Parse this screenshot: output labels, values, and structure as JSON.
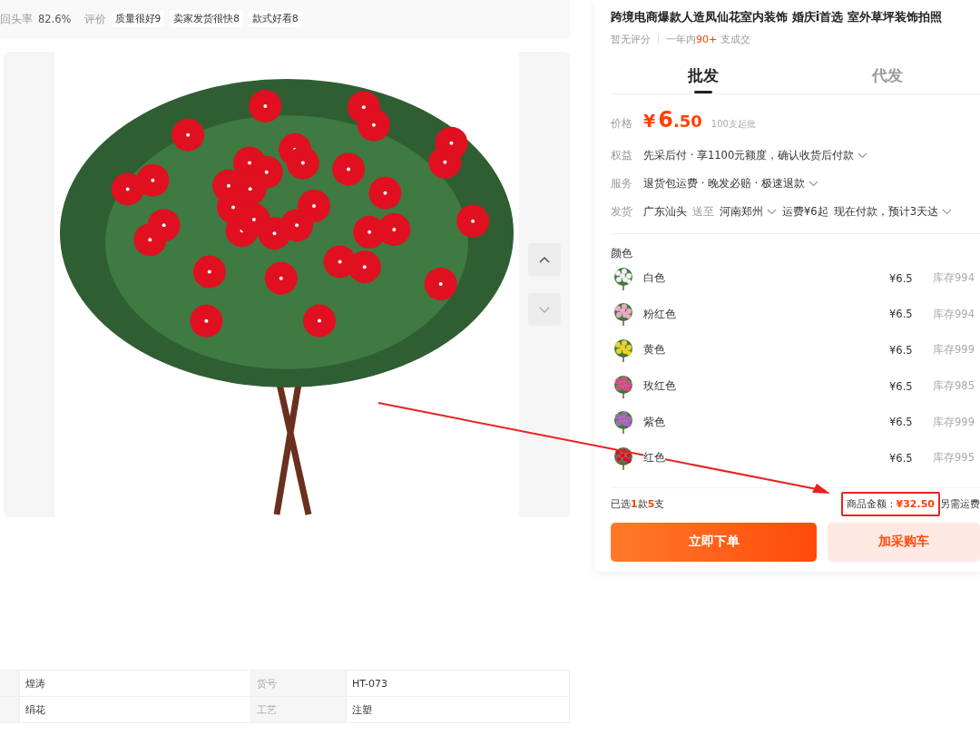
{
  "header": {
    "repurchase_label": "回头率",
    "repurchase_rate": "82.6%",
    "reviews_label": "评价",
    "review_tags": [
      "质量很好9",
      "卖家发货很快8",
      "款式好看8"
    ]
  },
  "product": {
    "title": "跨境电商爆款人造凤仙花室内装饰 婚庆i首选 室外草坪装饰拍照",
    "rating": "暂无评分",
    "sales_prefix": "一年内",
    "sales_count": "90+",
    "sales_suffix": " 支成交"
  },
  "tabs": [
    {
      "label": "批发",
      "selected": true
    },
    {
      "label": "代发",
      "selected": false
    }
  ],
  "price": {
    "label": "价格",
    "currency": "¥",
    "integer": "6",
    "decimal": ".50",
    "min_order": "100支起批"
  },
  "info_rows": [
    {
      "label": "权益",
      "segments": [
        {
          "kind": "dropdown",
          "text": "先采后付 · 享1100元额度，确认收货后付款"
        }
      ]
    },
    {
      "label": "服务",
      "segments": [
        {
          "kind": "dropdown",
          "text": "退货包运费 · 晚发必赔 · 极速退款"
        }
      ]
    },
    {
      "label": "发货",
      "segments": [
        {
          "kind": "text",
          "text": "广东汕头"
        },
        {
          "kind": "muted",
          "text": "送至"
        },
        {
          "kind": "dropdown",
          "text": "河南郑州"
        },
        {
          "kind": "text",
          "text": "运费¥6起"
        },
        {
          "kind": "dropdown",
          "text": "现在付款，预计3天达"
        }
      ]
    }
  ],
  "colors": {
    "label": "颜色",
    "options": [
      {
        "name": "白色",
        "price": "¥6.5",
        "stock": "库存994",
        "color": "#f2f2f2"
      },
      {
        "name": "粉红色",
        "price": "¥6.5",
        "stock": "库存994",
        "color": "#f0a6c8"
      },
      {
        "name": "黄色",
        "price": "¥6.5",
        "stock": "库存999",
        "color": "#f2d21c"
      },
      {
        "name": "玫红色",
        "price": "¥6.5",
        "stock": "库存985",
        "color": "#e83f86"
      },
      {
        "name": "紫色",
        "price": "¥6.5",
        "stock": "库存999",
        "color": "#b05cc8"
      },
      {
        "name": "红色",
        "price": "¥6.5",
        "stock": "库存995",
        "color": "#d0142a"
      }
    ]
  },
  "summary": {
    "selected_prefix": "已选",
    "styles": "1",
    "styles_unit": "款",
    "quantity": "5",
    "quantity_unit": "支",
    "amount_label": "商品金额：",
    "amount": "¥32.50",
    "highlighted": true,
    "shipping_note": "另需运费"
  },
  "buttons": [
    {
      "label": "立即下单",
      "kind": "primary"
    },
    {
      "label": "加采购车",
      "kind": "secondary"
    }
  ],
  "specs": [
    {
      "value_1": "煌涛",
      "label_2": "货号",
      "value_2": "HT-073"
    },
    {
      "value_1": "绢花",
      "label_2": "工艺",
      "value_2": "注塑"
    }
  ]
}
